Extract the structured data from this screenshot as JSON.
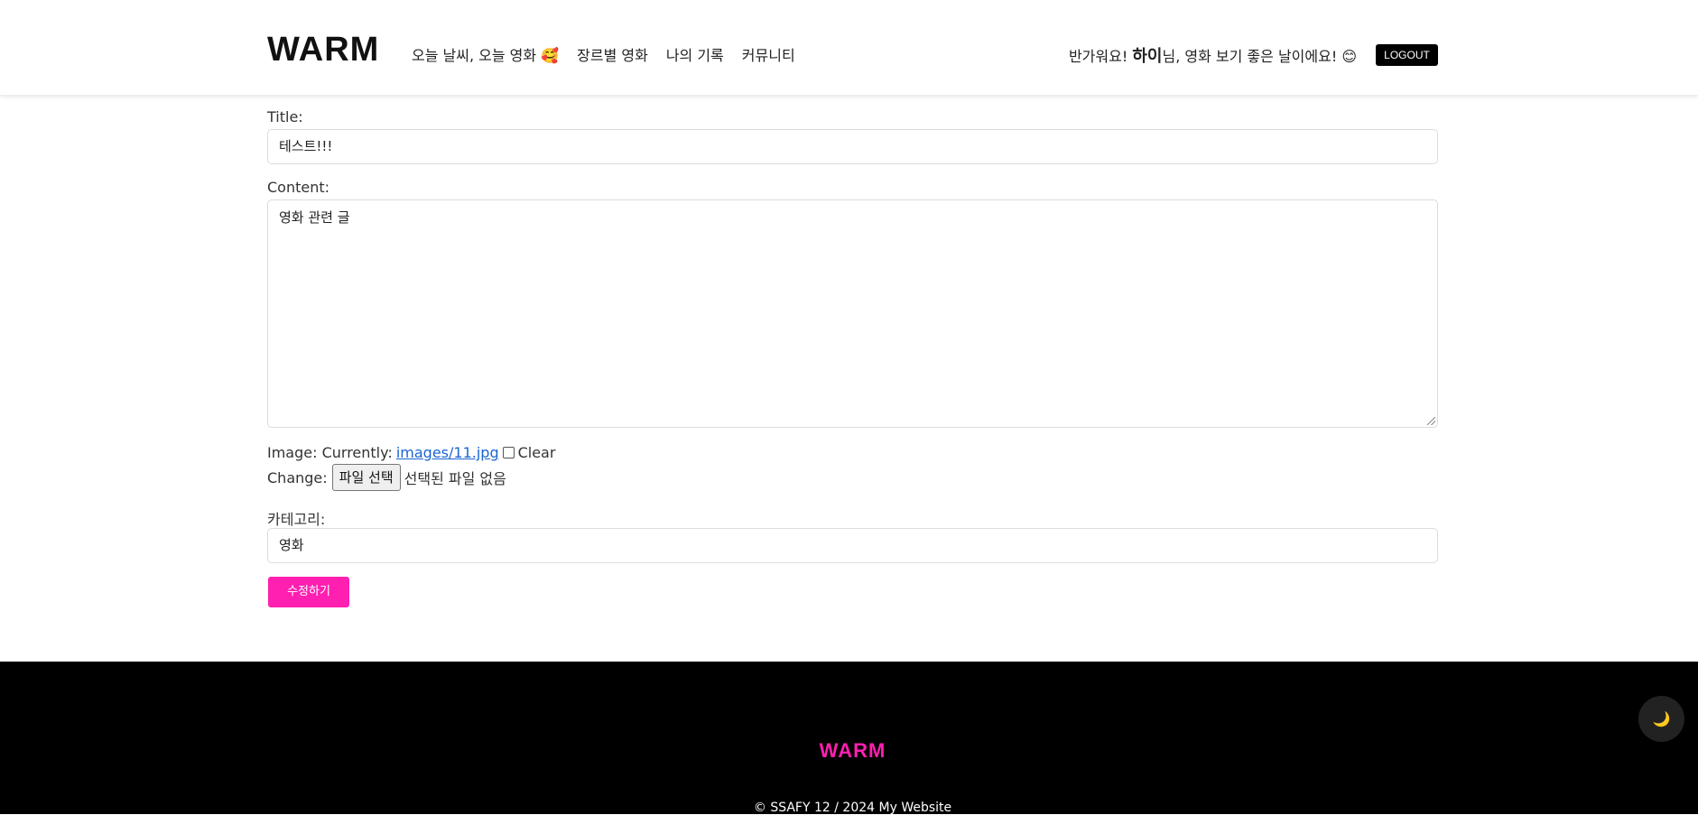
{
  "header": {
    "logo": "WARM",
    "nav": [
      {
        "label": "오늘 날씨, 오늘 영화 🥰"
      },
      {
        "label": "장르별 영화"
      },
      {
        "label": "나의 기록"
      },
      {
        "label": "커뮤니티"
      }
    ],
    "greeting_prefix": "반가워요! ",
    "username": "하이",
    "greeting_suffix": "님, 영화 보기 좋은 날이에요! 😊",
    "logout_label": "LOGOUT"
  },
  "form": {
    "title_label": "Title:",
    "title_value": "테스트!!!",
    "content_label": "Content:",
    "content_value": "영화 관련 글",
    "image_label": "Image: Currently:",
    "image_link": "images/11.jpg",
    "clear_label": "Clear",
    "change_label": "Change:",
    "file_button": "파일 선택",
    "file_status": "선택된 파일 없음",
    "category_label": "카테고리:",
    "category_value": "영화",
    "submit_label": "수정하기"
  },
  "footer": {
    "logo": "WARM",
    "copyright": "© SSAFY 12 / 2024 My Website"
  },
  "dark_mode_icon": "🌙",
  "colors": {
    "accent": "#ff1fb0",
    "link": "#1a64d4",
    "footer_bg": "#000000"
  }
}
